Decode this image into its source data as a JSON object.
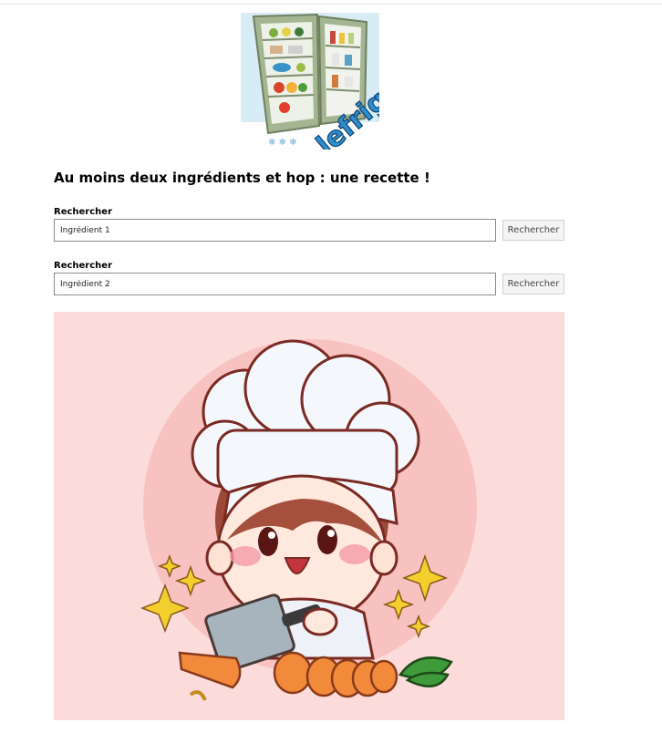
{
  "header": {
    "logo": {
      "icon": "open-fridge-logo",
      "wordmark": "lefrigo"
    }
  },
  "main": {
    "title": "Au moins deux ingrédients et hop : une recette !",
    "search_1": {
      "label": "Rechercher",
      "value": "Ingrédient 1",
      "button": "Rechercher"
    },
    "search_2": {
      "label": "Rechercher",
      "value": "Ingrédient 2",
      "button": "Rechercher"
    },
    "illustration": {
      "icon": "chef-cutting-carrots-illustration"
    }
  },
  "colors": {
    "hero_background": "#fbdcdb",
    "hero_circle": "#f8c2c0",
    "fridge_body": "#a3b591",
    "chef_hat": "#f4f7fb",
    "carrot": "#f08a3a",
    "sparkle": "#f3cf2e"
  }
}
